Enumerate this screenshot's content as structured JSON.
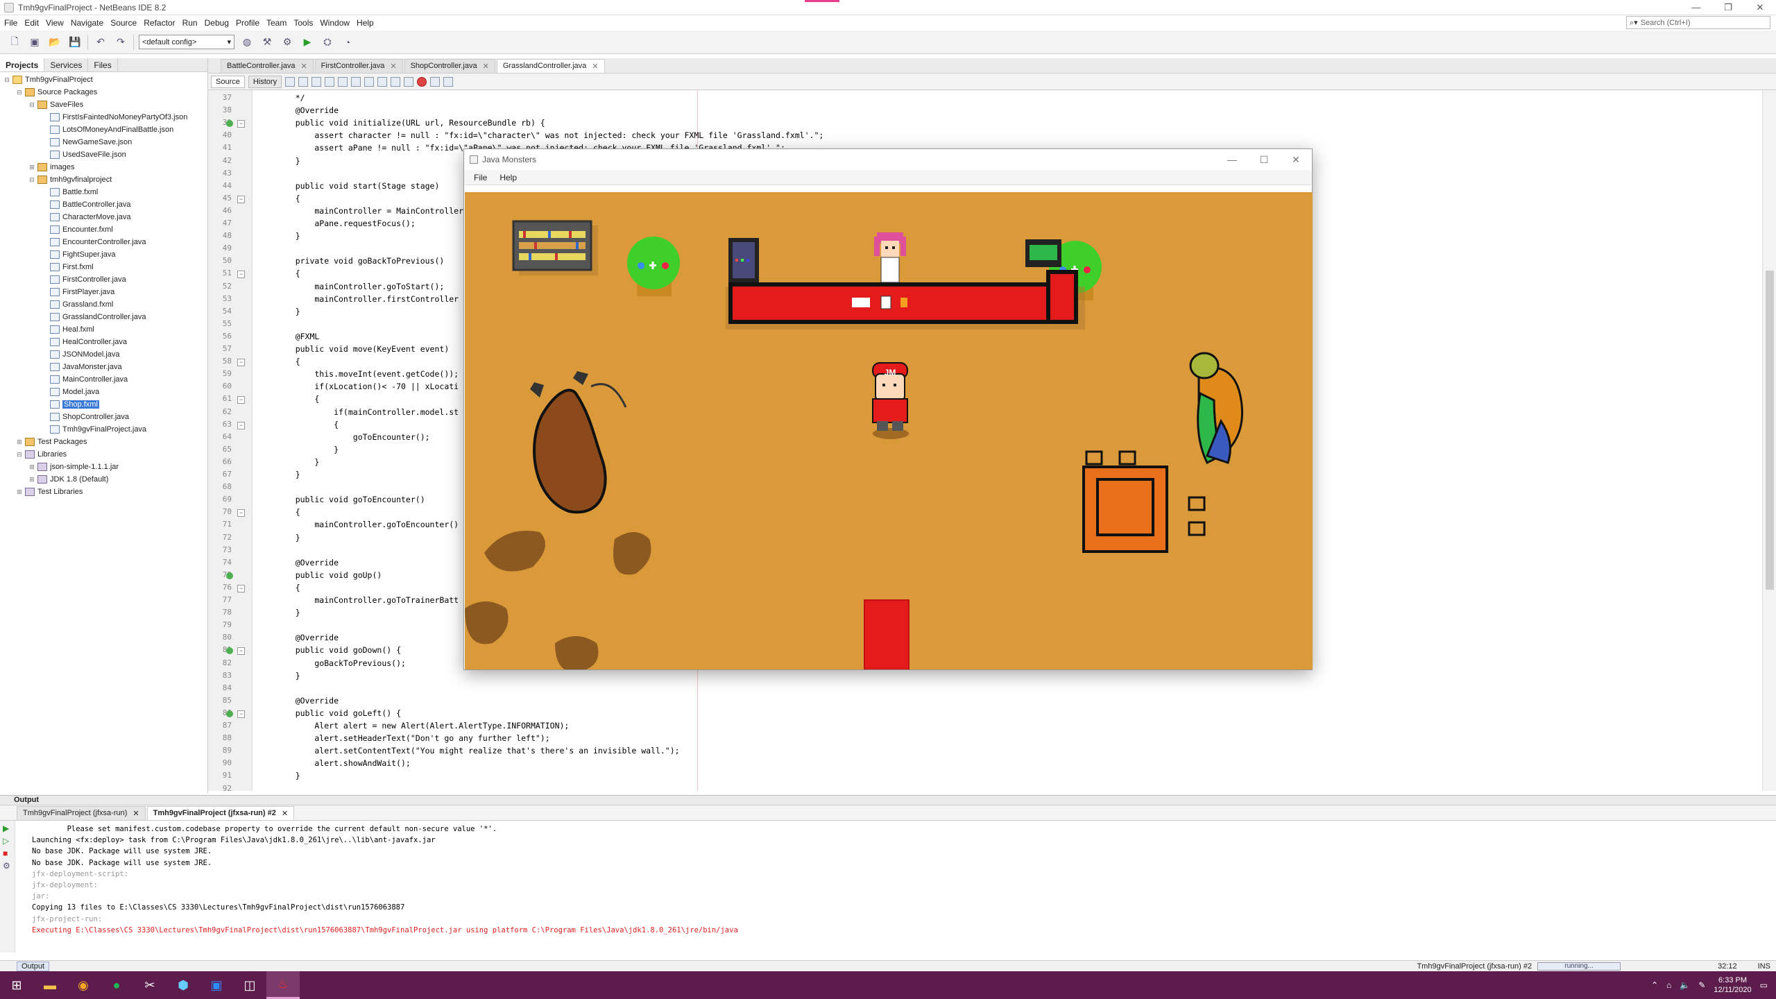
{
  "window": {
    "title": "Tmh9gvFinalProject - NetBeans IDE 8.2"
  },
  "menubar": [
    "File",
    "Edit",
    "View",
    "Navigate",
    "Source",
    "Refactor",
    "Run",
    "Debug",
    "Profile",
    "Team",
    "Tools",
    "Window",
    "Help"
  ],
  "search": {
    "placeholder": "Search (Ctrl+I)"
  },
  "toolbar": {
    "config": "<default config>"
  },
  "projects_panel": {
    "tabs": [
      "Projects",
      "Services",
      "Files"
    ],
    "tree": [
      {
        "level": 0,
        "icon": "proj",
        "label": "Tmh9gvFinalProject",
        "tw": "−"
      },
      {
        "level": 1,
        "icon": "pkg",
        "label": "Source Packages",
        "tw": "−"
      },
      {
        "level": 2,
        "icon": "pkg",
        "label": "SaveFiles",
        "tw": "−"
      },
      {
        "level": 3,
        "icon": "file",
        "label": "FirstIsFaintedNoMoneyPartyOf3.json"
      },
      {
        "level": 3,
        "icon": "file",
        "label": "LotsOfMoneyAndFinalBattle.json"
      },
      {
        "level": 3,
        "icon": "file",
        "label": "NewGameSave.json"
      },
      {
        "level": 3,
        "icon": "file",
        "label": "UsedSaveFile.json"
      },
      {
        "level": 2,
        "icon": "pkg",
        "label": "images",
        "tw": "+"
      },
      {
        "level": 2,
        "icon": "pkg",
        "label": "tmh9gvfinalproject",
        "tw": "−"
      },
      {
        "level": 3,
        "icon": "file",
        "label": "Battle.fxml"
      },
      {
        "level": 3,
        "icon": "file",
        "label": "BattleController.java"
      },
      {
        "level": 3,
        "icon": "file",
        "label": "CharacterMove.java"
      },
      {
        "level": 3,
        "icon": "file",
        "label": "Encounter.fxml"
      },
      {
        "level": 3,
        "icon": "file",
        "label": "EncounterController.java"
      },
      {
        "level": 3,
        "icon": "file",
        "label": "FightSuper.java"
      },
      {
        "level": 3,
        "icon": "file",
        "label": "First.fxml"
      },
      {
        "level": 3,
        "icon": "file",
        "label": "FirstController.java"
      },
      {
        "level": 3,
        "icon": "file",
        "label": "FirstPlayer.java"
      },
      {
        "level": 3,
        "icon": "file",
        "label": "Grassland.fxml"
      },
      {
        "level": 3,
        "icon": "file",
        "label": "GrasslandController.java"
      },
      {
        "level": 3,
        "icon": "file",
        "label": "Heal.fxml"
      },
      {
        "level": 3,
        "icon": "file",
        "label": "HealController.java"
      },
      {
        "level": 3,
        "icon": "file",
        "label": "JSONModel.java"
      },
      {
        "level": 3,
        "icon": "file",
        "label": "JavaMonster.java"
      },
      {
        "level": 3,
        "icon": "file",
        "label": "MainController.java"
      },
      {
        "level": 3,
        "icon": "file",
        "label": "Model.java"
      },
      {
        "level": 3,
        "icon": "file",
        "label": "Shop.fxml",
        "selected": true
      },
      {
        "level": 3,
        "icon": "file",
        "label": "ShopController.java"
      },
      {
        "level": 3,
        "icon": "file",
        "label": "Tmh9gvFinalProject.java"
      },
      {
        "level": 1,
        "icon": "pkg",
        "label": "Test Packages",
        "tw": "+"
      },
      {
        "level": 1,
        "icon": "lib",
        "label": "Libraries",
        "tw": "−"
      },
      {
        "level": 2,
        "icon": "lib",
        "label": "json-simple-1.1.1.jar",
        "tw": "+"
      },
      {
        "level": 2,
        "icon": "lib",
        "label": "JDK 1.8 (Default)",
        "tw": "+"
      },
      {
        "level": 1,
        "icon": "lib",
        "label": "Test Libraries",
        "tw": "+"
      }
    ]
  },
  "editor_tabs": [
    {
      "label": "BattleController.java",
      "active": false
    },
    {
      "label": "FirstController.java",
      "active": false
    },
    {
      "label": "ShopController.java",
      "active": false
    },
    {
      "label": "GrasslandController.java",
      "active": true
    }
  ],
  "source_bar": {
    "source": "Source",
    "history": "History"
  },
  "code_lines": [
    {
      "n": 37,
      "t": "    */"
    },
    {
      "n": 38,
      "t": "    @Override"
    },
    {
      "n": 39,
      "t": "    public void initialize(URL url, ResourceBundle rb) {",
      "mark": true,
      "fold": true
    },
    {
      "n": 40,
      "t": "        assert character != null : \"fx:id=\\\"character\\\" was not injected: check your FXML file 'Grassland.fxml'.\";"
    },
    {
      "n": 41,
      "t": "        assert aPane != null : \"fx:id=\\\"aPane\\\" was not injected: check your FXML file 'Grassland.fxml'.\";"
    },
    {
      "n": 42,
      "t": "    }"
    },
    {
      "n": 43,
      "t": ""
    },
    {
      "n": 44,
      "t": "    public void start(Stage stage)"
    },
    {
      "n": 45,
      "t": "    {",
      "fold": true
    },
    {
      "n": 46,
      "t": "        mainController = MainController"
    },
    {
      "n": 47,
      "t": "        aPane.requestFocus();"
    },
    {
      "n": 48,
      "t": "    }"
    },
    {
      "n": 49,
      "t": ""
    },
    {
      "n": 50,
      "t": "    private void goBackToPrevious()"
    },
    {
      "n": 51,
      "t": "    {",
      "fold": true
    },
    {
      "n": 52,
      "t": "        mainController.goToStart();"
    },
    {
      "n": 53,
      "t": "        mainController.firstController"
    },
    {
      "n": 54,
      "t": "    }"
    },
    {
      "n": 55,
      "t": ""
    },
    {
      "n": 56,
      "t": "    @FXML"
    },
    {
      "n": 57,
      "t": "    public void move(KeyEvent event)"
    },
    {
      "n": 58,
      "t": "    {",
      "fold": true
    },
    {
      "n": 59,
      "t": "        this.moveInt(event.getCode());"
    },
    {
      "n": 60,
      "t": "        if(xLocation()< -70 || xLocati"
    },
    {
      "n": 61,
      "t": "        {",
      "fold": true
    },
    {
      "n": 62,
      "t": "            if(mainController.model.st"
    },
    {
      "n": 63,
      "t": "            {",
      "fold": true
    },
    {
      "n": 64,
      "t": "                goToEncounter();"
    },
    {
      "n": 65,
      "t": "            }"
    },
    {
      "n": 66,
      "t": "        }"
    },
    {
      "n": 67,
      "t": "    }"
    },
    {
      "n": 68,
      "t": ""
    },
    {
      "n": 69,
      "t": "    public void goToEncounter()"
    },
    {
      "n": 70,
      "t": "    {",
      "fold": true
    },
    {
      "n": 71,
      "t": "        mainController.goToEncounter()"
    },
    {
      "n": 72,
      "t": "    }"
    },
    {
      "n": 73,
      "t": ""
    },
    {
      "n": 74,
      "t": "    @Override"
    },
    {
      "n": 75,
      "t": "    public void goUp()",
      "mark": true
    },
    {
      "n": 76,
      "t": "    {",
      "fold": true
    },
    {
      "n": 77,
      "t": "        mainController.goToTrainerBatt"
    },
    {
      "n": 78,
      "t": "    }"
    },
    {
      "n": 79,
      "t": ""
    },
    {
      "n": 80,
      "t": "    @Override"
    },
    {
      "n": 81,
      "t": "    public void goDown() {",
      "mark": true,
      "fold": true
    },
    {
      "n": 82,
      "t": "        goBackToPrevious();"
    },
    {
      "n": 83,
      "t": "    }"
    },
    {
      "n": 84,
      "t": ""
    },
    {
      "n": 85,
      "t": "    @Override"
    },
    {
      "n": 86,
      "t": "    public void goLeft() {",
      "mark": true,
      "fold": true
    },
    {
      "n": 87,
      "t": "        Alert alert = new Alert(Alert.AlertType.INFORMATION);"
    },
    {
      "n": 88,
      "t": "        alert.setHeaderText(\"Don't go any further left\");"
    },
    {
      "n": 89,
      "t": "        alert.setContentText(\"You might realize that's there's an invisible wall.\");"
    },
    {
      "n": 90,
      "t": "        alert.showAndWait();"
    },
    {
      "n": 91,
      "t": "    }"
    },
    {
      "n": 92,
      "t": ""
    }
  ],
  "game_window": {
    "title": "Java Monsters",
    "menu": [
      "File",
      "Help"
    ],
    "player_cap_text": "JM"
  },
  "output_panel": {
    "title": "Output",
    "tabs": [
      {
        "label": "Tmh9gvFinalProject (jfxsa-run)",
        "active": false
      },
      {
        "label": "Tmh9gvFinalProject (jfxsa-run) #2",
        "active": true
      }
    ],
    "lines": [
      {
        "c": "blk",
        "t": "        Please set manifest.custom.codebase property to override the current default non-secure value '*'."
      },
      {
        "c": "blk",
        "t": "Launching <fx:deploy> task from C:\\Program Files\\Java\\jdk1.8.0_261\\jre\\..\\lib\\ant-javafx.jar"
      },
      {
        "c": "blk",
        "t": "No base JDK. Package will use system JRE."
      },
      {
        "c": "blk",
        "t": "No base JDK. Package will use system JRE."
      },
      {
        "c": "gray",
        "t": "jfx-deployment-script:"
      },
      {
        "c": "gray",
        "t": "jfx-deployment:"
      },
      {
        "c": "gray",
        "t": "jar:"
      },
      {
        "c": "blk",
        "t": "Copying 13 files to E:\\Classes\\CS 3330\\Lectures\\Tmh9gvFinalProject\\dist\\run1576063887"
      },
      {
        "c": "gray",
        "t": "jfx-project-run:"
      },
      {
        "c": "red",
        "t": "Executing E:\\Classes\\CS 3330\\Lectures\\Tmh9gvFinalProject\\dist\\run1576063887\\Tmh9gvFinalProject.jar using platform C:\\Program Files\\Java\\jdk1.8.0_261\\jre/bin/java"
      }
    ]
  },
  "statusbar": {
    "output_btn": "Output",
    "run_label": "Tmh9gvFinalProject (jfxsa-run) #2",
    "progress": "running...",
    "position": "32:12",
    "mode": "INS"
  },
  "taskbar": {
    "time": "6:33 PM",
    "date": "12/11/2020"
  },
  "colors": {
    "taskbar": "#5c1c4c",
    "scene_floor": "#db9a3a",
    "counter": "#e31b1b",
    "selection": "#3878d8"
  }
}
